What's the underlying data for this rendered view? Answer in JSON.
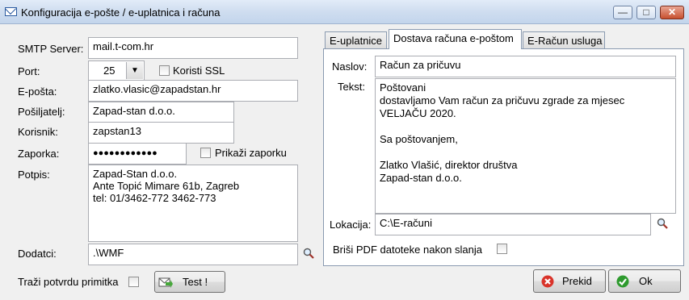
{
  "window": {
    "title": "Konfiguracija e-pošte / e-uplatnica i računa",
    "buttons": {
      "minimize": "—",
      "maximize": "□",
      "close": "✕"
    }
  },
  "left": {
    "smtp_label": "SMTP Server:",
    "smtp_value": "mail.t-com.hr",
    "port_label": "Port:",
    "port_value": "25",
    "ssl_label": "Koristi SSL",
    "email_label": "E-pošta:",
    "email_value": "zlatko.vlasic@zapadstan.hr",
    "sender_label": "Pošiljatelj:",
    "sender_value": "Zapad-stan d.o.o.",
    "user_label": "Korisnik:",
    "user_value": "zapstan13",
    "password_label": "Zaporka:",
    "password_value": "●●●●●●●●●●●●",
    "show_password_label": "Prikaži zaporku",
    "signature_label": "Potpis:",
    "signature_value": "Zapad-Stan d.o.o.\nAnte Topić Mimare 61b, Zagreb\ntel: 01/3462-772 3462-773",
    "attachments_label": "Dodatci:",
    "attachments_value": ".\\WMF",
    "receipt_label": "Traži potvrdu primitka",
    "test_button": "Test !"
  },
  "tabs": [
    {
      "label": "E-uplatnice",
      "active": false
    },
    {
      "label": "Dostava računa e-poštom",
      "active": true
    },
    {
      "label": "E-Račun usluga",
      "active": false
    }
  ],
  "panel": {
    "subject_label": "Naslov:",
    "subject_value": "Račun za pričuvu",
    "body_label": "Tekst:",
    "body_value": "Poštovani\ndostavljamo Vam račun za pričuvu zgrade za mjesec\nVELJAČU 2020.\n\nSa poštovanjem,\n\nZlatko Vlašić, direktor društva\nZapad-stan d.o.o.",
    "location_label": "Lokacija:",
    "location_value": "C:\\E-računi",
    "delete_pdf_label": "Briši PDF datoteke nakon slanja"
  },
  "footer": {
    "cancel_button": "Prekid",
    "ok_button": "Ok"
  },
  "colors": {
    "titlebar": "#cddcef",
    "cancel_icon": "#d9332a",
    "ok_icon": "#2e9a2e"
  }
}
